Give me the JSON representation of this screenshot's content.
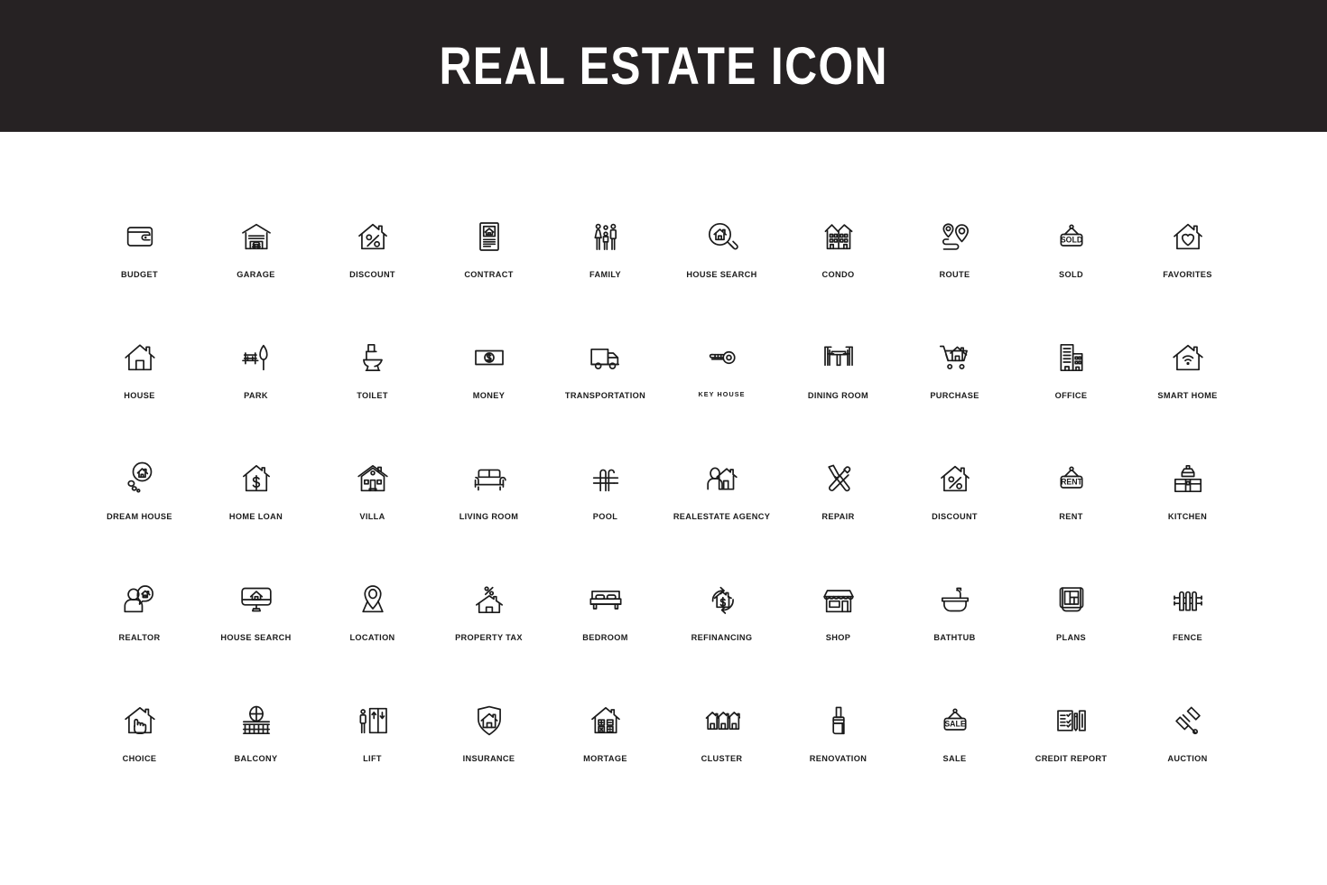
{
  "header": {
    "title": "REAL ESTATE ICON",
    "background_color": "#262223",
    "text_color": "#ffffff"
  },
  "style": {
    "icon_stroke_color": "#1b1b1b",
    "page_background": "#ffffff",
    "label_color": "#1b1b1b"
  },
  "grid": {
    "columns": 10,
    "rows": 5,
    "total_icons": 50
  },
  "icons": [
    {
      "label": "BUDGET",
      "icon": "wallet-icon",
      "small_label": false
    },
    {
      "label": "GARAGE",
      "icon": "garage-icon",
      "small_label": false
    },
    {
      "label": "DISCOUNT",
      "icon": "house-percent-icon",
      "small_label": false
    },
    {
      "label": "CONTRACT",
      "icon": "contract-document-icon",
      "small_label": false
    },
    {
      "label": "FAMILY",
      "icon": "family-icon",
      "small_label": false
    },
    {
      "label": "HOUSE SEARCH",
      "icon": "house-magnifier-icon",
      "small_label": false
    },
    {
      "label": "CONDO",
      "icon": "condo-buildings-icon",
      "small_label": false
    },
    {
      "label": "ROUTE",
      "icon": "route-pins-icon",
      "small_label": false
    },
    {
      "label": "SOLD",
      "icon": "sold-sign-icon",
      "small_label": false
    },
    {
      "label": "FAVORITES",
      "icon": "house-heart-icon",
      "small_label": false
    },
    {
      "label": "HOUSE",
      "icon": "house-icon",
      "small_label": false
    },
    {
      "label": "PARK",
      "icon": "park-bench-tree-icon",
      "small_label": false
    },
    {
      "label": "TOILET",
      "icon": "toilet-icon",
      "small_label": false
    },
    {
      "label": "MONEY",
      "icon": "banknote-icon",
      "small_label": false
    },
    {
      "label": "TRANSPORTATION",
      "icon": "moving-truck-icon",
      "small_label": false
    },
    {
      "label": "KEY HOUSE",
      "icon": "key-icon",
      "small_label": true
    },
    {
      "label": "DINING ROOM",
      "icon": "dining-table-icon",
      "small_label": false
    },
    {
      "label": "PURCHASE",
      "icon": "cart-house-icon",
      "small_label": false
    },
    {
      "label": "OFFICE",
      "icon": "office-tower-icon",
      "small_label": false
    },
    {
      "label": "SMART HOME",
      "icon": "house-wifi-icon",
      "small_label": false
    },
    {
      "label": "DREAM HOUSE",
      "icon": "thought-bubble-house-icon",
      "small_label": false
    },
    {
      "label": "HOME LOAN",
      "icon": "house-dollar-icon",
      "small_label": false
    },
    {
      "label": "VILLA",
      "icon": "villa-icon",
      "small_label": false
    },
    {
      "label": "LIVING ROOM",
      "icon": "sofa-icon",
      "small_label": false
    },
    {
      "label": "POOL",
      "icon": "pool-ladder-icon",
      "small_label": false
    },
    {
      "label": "REALESTATE AGENCY",
      "icon": "agent-house-icon",
      "small_label": false
    },
    {
      "label": "REPAIR",
      "icon": "hammer-screwdriver-icon",
      "small_label": false
    },
    {
      "label": "DISCOUNT",
      "icon": "house-percent-icon",
      "small_label": false
    },
    {
      "label": "RENT",
      "icon": "rent-sign-icon",
      "small_label": false
    },
    {
      "label": "KITCHEN",
      "icon": "kitchen-cabinet-icon",
      "small_label": false
    },
    {
      "label": "REALTOR",
      "icon": "realtor-person-icon",
      "small_label": false
    },
    {
      "label": "HOUSE SEARCH",
      "icon": "monitor-house-icon",
      "small_label": false
    },
    {
      "label": "LOCATION",
      "icon": "map-pin-icon",
      "small_label": false
    },
    {
      "label": "PROPERTY TAX",
      "icon": "house-tax-percent-icon",
      "small_label": false
    },
    {
      "label": "BEDROOM",
      "icon": "bed-icon",
      "small_label": false
    },
    {
      "label": "REFINANCING",
      "icon": "refinance-arrows-icon",
      "small_label": false
    },
    {
      "label": "SHOP",
      "icon": "shop-storefront-icon",
      "small_label": false
    },
    {
      "label": "BATHTUB",
      "icon": "bathtub-icon",
      "small_label": false
    },
    {
      "label": "PLANS",
      "icon": "blueprint-scroll-icon",
      "small_label": false
    },
    {
      "label": "FENCE",
      "icon": "fence-icon",
      "small_label": false
    },
    {
      "label": "CHOICE",
      "icon": "house-hand-pointer-icon",
      "small_label": false
    },
    {
      "label": "BALCONY",
      "icon": "balcony-railing-icon",
      "small_label": false
    },
    {
      "label": "LIFT",
      "icon": "elevator-icon",
      "small_label": false
    },
    {
      "label": "INSURANCE",
      "icon": "shield-house-icon",
      "small_label": false
    },
    {
      "label": "MORTAGE",
      "icon": "house-calculator-icon",
      "small_label": false
    },
    {
      "label": "CLUSTER",
      "icon": "three-houses-icon",
      "small_label": false
    },
    {
      "label": "RENOVATION",
      "icon": "paint-brush-icon",
      "small_label": false
    },
    {
      "label": "SALE",
      "icon": "sale-sign-icon",
      "small_label": false
    },
    {
      "label": "CREDIT REPORT",
      "icon": "credit-report-icon",
      "small_label": false
    },
    {
      "label": "AUCTION",
      "icon": "auction-gavel-icon",
      "small_label": false
    }
  ],
  "sign_text": {
    "sold": "SOLD",
    "rent": "RENT",
    "sale": "SALE"
  }
}
